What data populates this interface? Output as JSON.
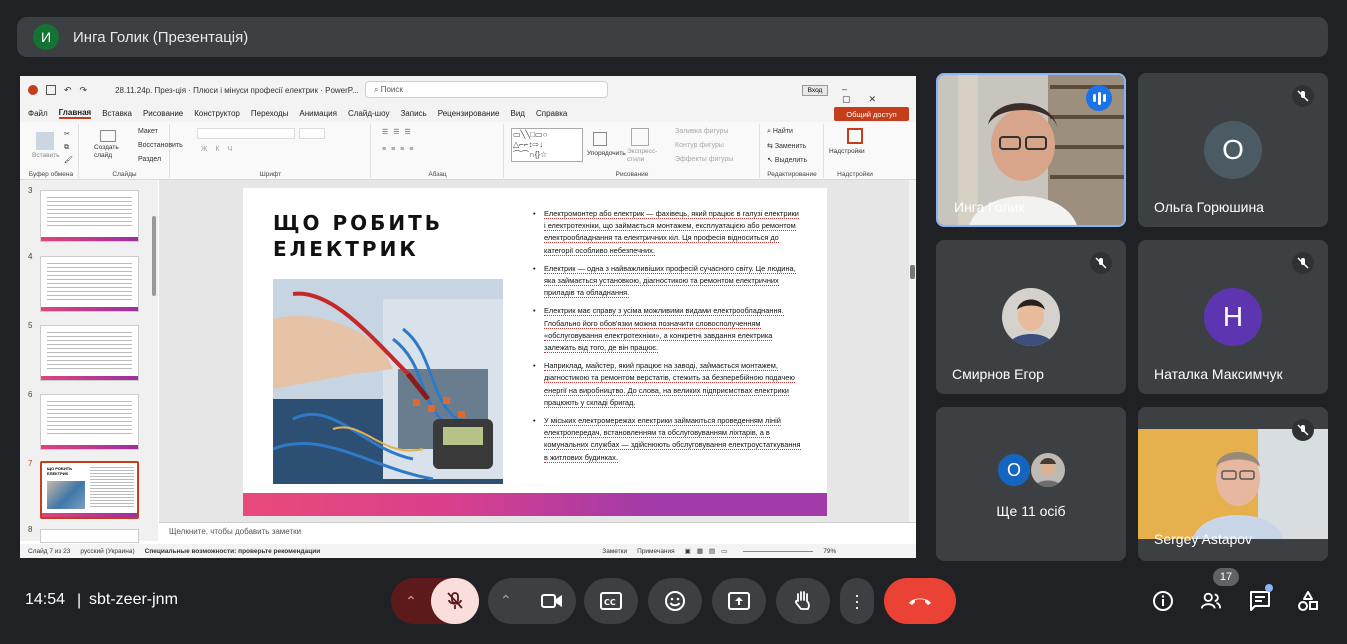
{
  "meeting": {
    "presenter_initial": "И",
    "presenter_title": "Инга Голик (Презентація)",
    "time": "14:54",
    "code": "sbt-zeer-jnm",
    "participants_badge": "17"
  },
  "powerpoint": {
    "window_title": "28.11.24р. През-ція · Плюси і мінуси професії електрик · PowerP...",
    "search_placeholder": "Поиск",
    "login": "Вход",
    "tabs": [
      "Файл",
      "Главная",
      "Вставка",
      "Рисование",
      "Конструктор",
      "Переходы",
      "Анимация",
      "Слайд-шоу",
      "Запись",
      "Рецензирование",
      "Вид",
      "Справка"
    ],
    "share_label": "Общий доступ",
    "ribbon": {
      "paste": "Вставить",
      "clipboard": "Буфер обмена",
      "new_slide": "Создать слайд",
      "layout": "Макет",
      "reset": "Восстановить",
      "section": "Раздел",
      "slides": "Слайды",
      "font": "Шрифт",
      "paragraph": "Абзац",
      "arrange": "Упорядочить",
      "express_styles": "Экспресс-стили",
      "shape_fill": "Заливка фигуры",
      "shape_outline": "Контур фигуры",
      "shape_effects": "Эффекты фигуры",
      "drawing": "Рисование",
      "find": "Найти",
      "replace": "Заменить",
      "select": "Выделить",
      "editing": "Редактирование",
      "addins_btn": "Надстройки",
      "addins": "Надстройки"
    },
    "thumb_numbers": [
      "3",
      "4",
      "5",
      "6",
      "7",
      "8"
    ],
    "thumb7_title": "ЩО РОБИТЬ ЕЛЕКТРИК",
    "notes_placeholder": "Щелкните, чтобы добавить заметки",
    "status": {
      "slide": "Слайд 7 из 23",
      "lang": "русский (Украина)",
      "accessibility": "Специальные возможности: проверьте рекомендации",
      "notes": "Заметки",
      "comments": "Примечания",
      "zoom": "79%"
    }
  },
  "slide": {
    "title_line1": "ЩО РОБИТЬ",
    "title_line2": "ЕЛЕКТРИК",
    "bullets": [
      "Електромонтер або електрик — фахівець, який працює в галузі електрики і електротехніки, що займається монтажем, експлуатацією або ремонтом електрообладнання та електричних кіл. Ця професія відноситься до категорії особливо небезпечних.",
      "Електрик — одна з найважливіших професій сучасного світу. Це людина, яка займається установкою, діагностикою та ремонтом електричних приладів та обладнання.",
      "Електрик має справу з усіма можливими видами електрообладнання. Глобально його обов'язки можна позначити словосполученням «обслуговування електротехніки», а конкретні завдання електрика залежать від того, де він працює.",
      "Наприклад, майстер, який працює на заводі, займається монтажем, діагностикою та ремонтом верстатів, стежить за безперебійною подачею енергії на виробництво. До слова, на великих підприємствах електрики працюють у складі бригад.",
      "У міських електромережах електрики займаються проведенням ліній електропередач, встановленням та обслуговуванням ліхтарів, а в комунальних службах — здійснюють обслуговування електроустаткування в житлових будинках."
    ]
  },
  "participants": [
    {
      "name": "Инга Голик"
    },
    {
      "name": "Ольга Горюшина",
      "initial": "О"
    },
    {
      "name": "Смирнов Егор"
    },
    {
      "name": "Наталка Максимчук",
      "initial": "Н"
    },
    {
      "name": "Ще 11 осіб",
      "initial": "О"
    },
    {
      "name": "Sergey Astapov"
    }
  ],
  "colors": {
    "meet_bg": "#202124",
    "tile_bg": "#3c4043",
    "end_call": "#ea4335",
    "mic_off_bg": "#f9dedc",
    "active_speaker": "#8ab4f8",
    "ppt_accent": "#c43e1c"
  }
}
